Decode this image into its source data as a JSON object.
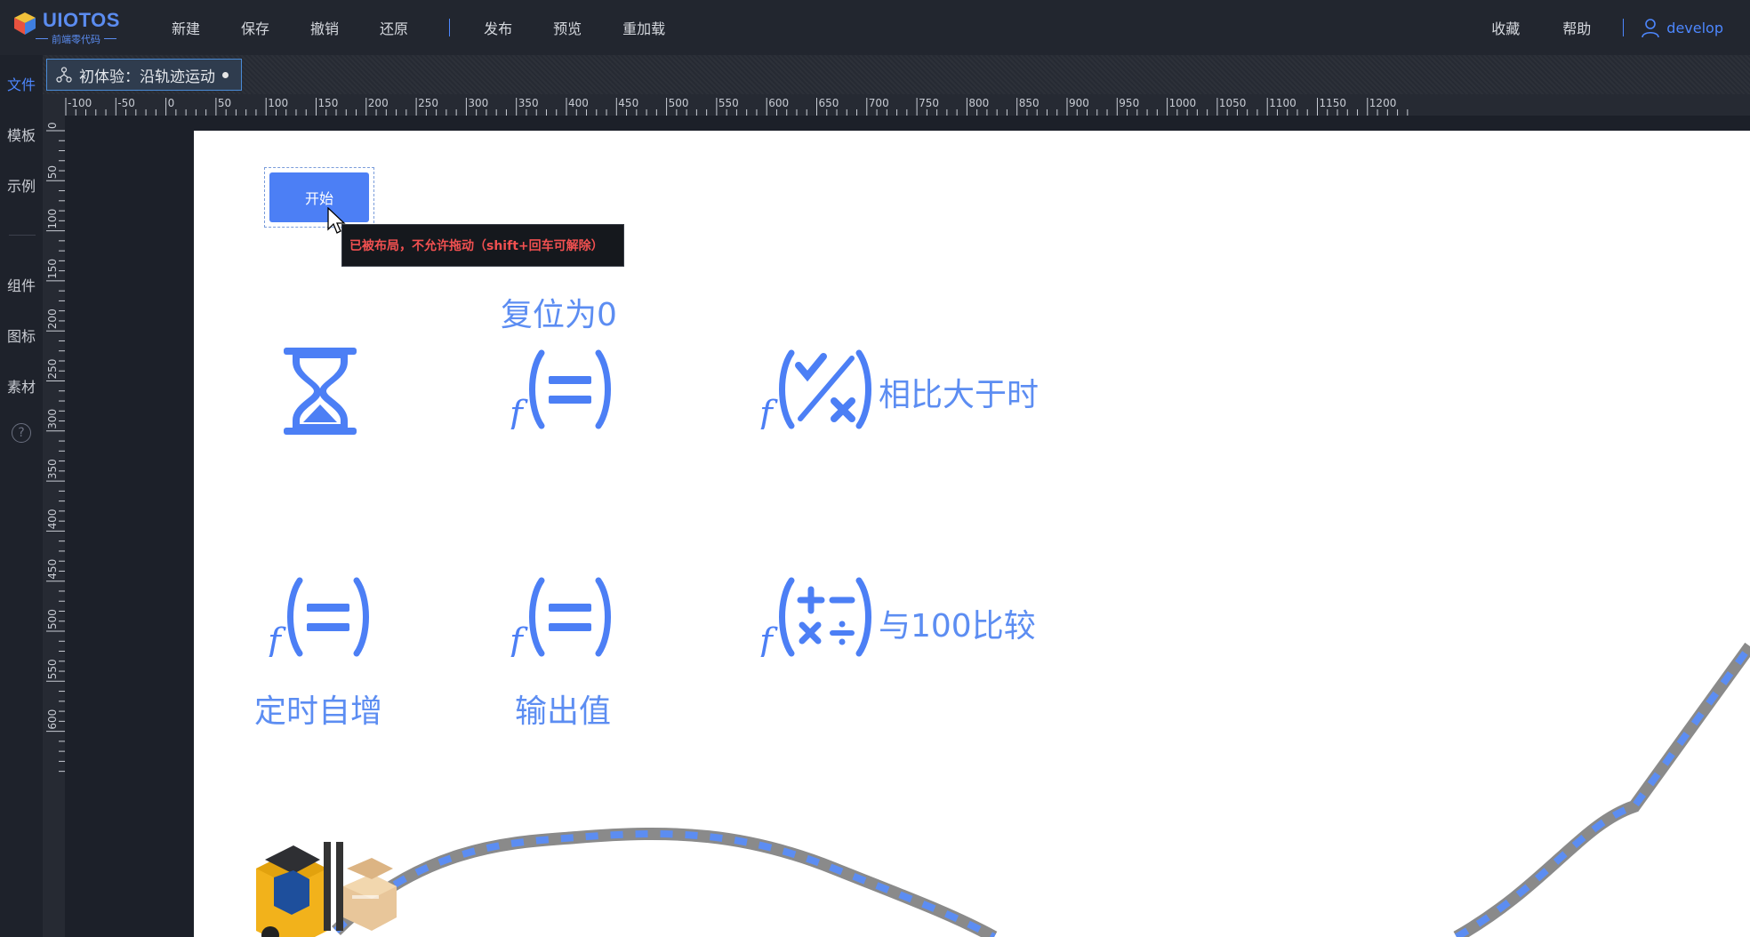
{
  "app": {
    "logo_text": "UIOTOS",
    "logo_sub": "前端零代码"
  },
  "menu": {
    "new": "新建",
    "save": "保存",
    "undo": "撤销",
    "redo": "还原",
    "publish": "发布",
    "preview": "预览",
    "reload": "重加载"
  },
  "right_menu": {
    "favorites": "收藏",
    "help": "帮助",
    "user": "develop"
  },
  "sidebar": {
    "items": [
      {
        "label": "文件",
        "active": true
      },
      {
        "label": "模板"
      },
      {
        "label": "示例"
      },
      {
        "label": "组件"
      },
      {
        "label": "图标"
      },
      {
        "label": "素材"
      }
    ],
    "help": "?"
  },
  "tab": {
    "title": "初体验：沿轨迹运动"
  },
  "ruler": {
    "h_labels": [
      "-100",
      "-50",
      "0",
      "50",
      "100",
      "150",
      "200",
      "250",
      "300",
      "350",
      "400",
      "450",
      "500",
      "550",
      "600",
      "650",
      "700",
      "750",
      "800",
      "850",
      "900",
      "950",
      "1000",
      "1050",
      "1100",
      "1150",
      "1200"
    ],
    "v_labels": [
      "0",
      "50",
      "100",
      "150",
      "200",
      "250",
      "300",
      "350",
      "400",
      "450",
      "500",
      "550",
      "600"
    ]
  },
  "canvas": {
    "start_button": "开始",
    "tooltip": "已被布局，不允许拖动（shift+回车可解除）",
    "reset_label": "复位为0",
    "compare_label": "相比大于时",
    "timer_label": "定时自增",
    "output_label": "输出值",
    "compare100_label": "与100比较"
  },
  "colors": {
    "accent": "#4d87ff",
    "func_blue": "#5c8df2",
    "button_blue": "#4c7ff5",
    "tooltip_text": "#f05050",
    "track_gray": "#8a8a8a",
    "track_blue": "#5c8df2"
  }
}
